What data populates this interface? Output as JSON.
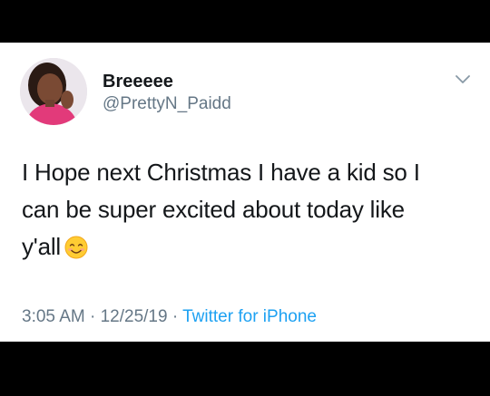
{
  "tweet": {
    "display_name": "Breeeee",
    "handle": "@PrettyN_Paidd",
    "text_line1": "I Hope next Christmas I have a kid so I",
    "text_line2": "can be super excited about today like",
    "text_line3": "y'all",
    "emoji": "smiling-face-with-smiling-eyes",
    "time": "3:05 AM",
    "separator": "·",
    "date": "12/25/19",
    "source": "Twitter for iPhone"
  },
  "colors": {
    "text_primary": "#14171a",
    "text_secondary": "#657786",
    "link": "#1da1f2",
    "background": "#ffffff",
    "letterbox": "#000000"
  },
  "icons": {
    "menu": "chevron-down-icon",
    "avatar": "profile-photo"
  }
}
